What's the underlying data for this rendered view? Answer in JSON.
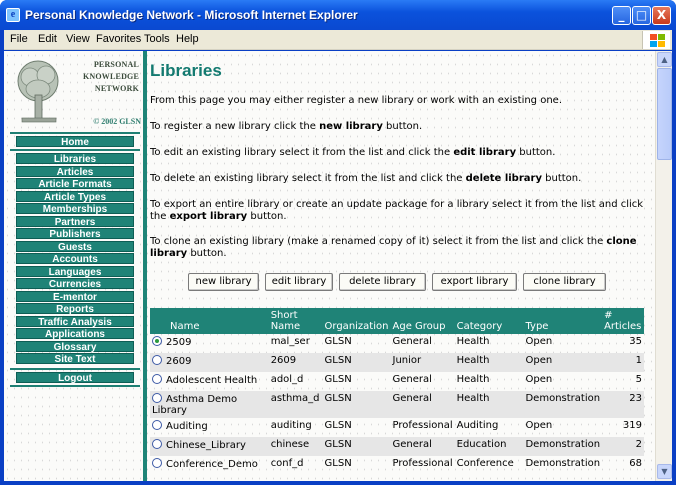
{
  "window": {
    "title": "Personal Knowledge Network - Microsoft Internet Explorer",
    "minimize_glyph": "_",
    "maximize_glyph": "□",
    "close_glyph": "X"
  },
  "menubar": {
    "items": [
      "File",
      "Edit",
      "View",
      "Favorites",
      "Tools",
      "Help"
    ]
  },
  "logo": {
    "line1": "PERSONAL",
    "line2": "KNOWLEDGE",
    "line3": "NETWORK",
    "copyright": "© 2002 GLSN"
  },
  "nav": {
    "home": "Home",
    "items": [
      "Libraries",
      "Articles",
      "Article Formats",
      "Article Types",
      "Memberships",
      "Partners",
      "Publishers",
      "Guests",
      "Accounts",
      "Languages",
      "Currencies",
      "E-mentor",
      "Reports",
      "Traffic Analysis",
      "Applications",
      "Glossary",
      "Site Text"
    ],
    "logout": "Logout"
  },
  "page": {
    "title": "Libraries",
    "intro": "From this page you may either register a new library or work with an existing one.",
    "p_register_pre": "To register a new library click the ",
    "p_register_bold": "new library",
    "p_register_post": " button.",
    "p_edit_pre": "To edit an existing library select it from the list and click the ",
    "p_edit_bold": "edit library",
    "p_edit_post": " button.",
    "p_delete_pre": "To delete an existing library select it from the list and click the ",
    "p_delete_bold": "delete library",
    "p_delete_post": " button.",
    "p_export_pre": "To export an entire library or create an update package for a library select it from the list and click the ",
    "p_export_bold": "export library",
    "p_export_post": " button.",
    "p_clone_pre": "To clone an existing library (make a renamed copy of it) select it from the list and click the ",
    "p_clone_bold": "clone library",
    "p_clone_post": " button."
  },
  "buttons": {
    "new": "new library",
    "edit": "edit library",
    "delete": "delete library",
    "export": "export library",
    "clone": "clone library"
  },
  "table": {
    "headers": [
      "Name",
      "Short Name",
      "Organization",
      "Age Group",
      "Category",
      "Type",
      "# Articles"
    ],
    "rows": [
      {
        "name": "2509",
        "short": "mal_ser",
        "org": "GLSN",
        "age": "General",
        "category": "Health",
        "type": "Open",
        "articles": "35",
        "selected": true
      },
      {
        "name": "2609",
        "short": "2609",
        "org": "GLSN",
        "age": "Junior",
        "category": "Health",
        "type": "Open",
        "articles": "1",
        "selected": false
      },
      {
        "name": "Adolescent Health",
        "short": "adol_d",
        "org": "GLSN",
        "age": "General",
        "category": "Health",
        "type": "Open",
        "articles": "5",
        "selected": false
      },
      {
        "name": "Asthma Demo Library",
        "short": "asthma_d",
        "org": "GLSN",
        "age": "General",
        "category": "Health",
        "type": "Demonstration",
        "articles": "23",
        "selected": false
      },
      {
        "name": "Auditing",
        "short": "auditing",
        "org": "GLSN",
        "age": "Professional",
        "category": "Auditing",
        "type": "Open",
        "articles": "319",
        "selected": false
      },
      {
        "name": "Chinese_Library",
        "short": "chinese",
        "org": "GLSN",
        "age": "General",
        "category": "Education",
        "type": "Demonstration",
        "articles": "2",
        "selected": false
      },
      {
        "name": "Conference_Demo",
        "short": "conf_d",
        "org": "GLSN",
        "age": "Professional",
        "category": "Conference",
        "type": "Demonstration",
        "articles": "68",
        "selected": false
      }
    ]
  },
  "scrollbar": {
    "up_glyph": "▲",
    "down_glyph": "▼"
  }
}
